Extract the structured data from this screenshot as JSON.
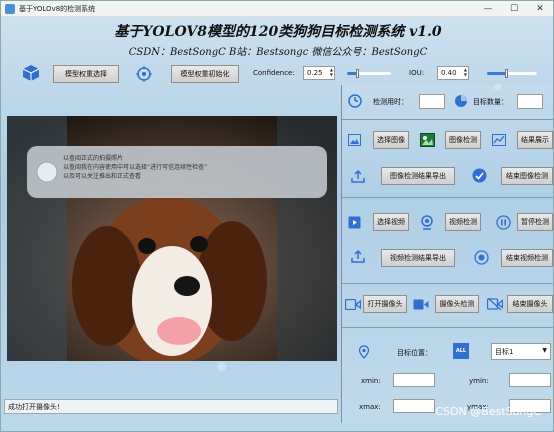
{
  "window": {
    "title": "基于YOLOv8的检测系统",
    "minimize": "—",
    "maximize": "☐",
    "close": "✕"
  },
  "header": {
    "title": "基于YOLOV8模型的120类狗狗目标检测系统 v1.0",
    "subtitle": "CSDN：BestSongC   B站：Bestsongc   微信公众号：BestSongC"
  },
  "toolbar": {
    "select_weights": "模型权重选择",
    "init_weights": "模型权重初始化",
    "confidence_label": "Confidence:",
    "confidence_value": "0.25",
    "confidence_level": 0.25,
    "iou_label": "IOU:",
    "iou_value": "0.40",
    "iou_level": 0.4
  },
  "stats": {
    "time_label": "检测用时：",
    "time_value": "",
    "count_label": "目标数量：",
    "count_value": ""
  },
  "image_section": {
    "select_image": "选择图像",
    "detect_image": "图像检测",
    "show_results": "结果展示",
    "export_image": "图像检测结果导出",
    "end_image": "结束图像检测"
  },
  "video_section": {
    "select_video": "选择视频",
    "detect_video": "视频检测",
    "pause_detect": "暂停检测",
    "export_video": "视频检测结果导出",
    "end_video": "结束视频检测"
  },
  "camera_section": {
    "open_camera": "打开摄像头",
    "camera_detect": "摄像头检测",
    "end_camera": "结束摄像头"
  },
  "target": {
    "position_label": "目标位置：",
    "all_label": "ALL",
    "selected": "目标1",
    "xmin_label": "xmin:",
    "ymin_label": "ymin:",
    "xmax_label": "xmax:",
    "ymax_label": "ymax:",
    "xmin": "",
    "ymin": "",
    "xmax": "",
    "ymax": ""
  },
  "video_overlay": {
    "line1": "以查阅正式的拍摄照片",
    "line2": "以查阅我在内容使用中可以选择“进行可信连续性检查”",
    "line3": "以及可以关注推出和正式查看"
  },
  "status": {
    "message": "成功打开摄像头!"
  },
  "watermark": "CSDN @BestSongC",
  "colors": {
    "accent": "#2f6fd0",
    "panel_bg": "#b9d6ea"
  }
}
